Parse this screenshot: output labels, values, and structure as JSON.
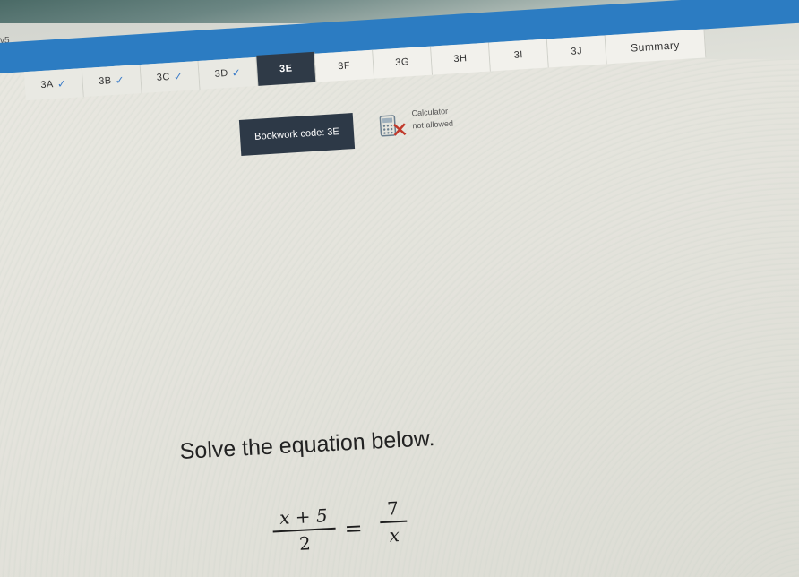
{
  "url_fragment": "v5",
  "tabs": [
    {
      "label": "3A",
      "done": true
    },
    {
      "label": "3B",
      "done": true
    },
    {
      "label": "3C",
      "done": true
    },
    {
      "label": "3D",
      "done": true
    },
    {
      "label": "3E",
      "done": false,
      "active": true
    },
    {
      "label": "3F",
      "done": false
    },
    {
      "label": "3G",
      "done": false
    },
    {
      "label": "3H",
      "done": false
    },
    {
      "label": "3I",
      "done": false
    },
    {
      "label": "3J",
      "done": false
    },
    {
      "label": "Summary",
      "done": false
    }
  ],
  "check_symbol": "✓",
  "bookwork": {
    "label": "Bookwork code: 3E"
  },
  "calculator": {
    "line1": "Calculator",
    "line2": "not allowed",
    "icon": "calculator-crossed-icon"
  },
  "question": {
    "prompt": "Solve the equation below.",
    "lhs_numerator": "x + 5",
    "lhs_denominator": "2",
    "equals": "=",
    "rhs_numerator": "7",
    "rhs_denominator": "x"
  },
  "colors": {
    "accent_blue": "#2c7cc2",
    "active_tab": "#2f3a47",
    "check": "#3a7bc8"
  }
}
